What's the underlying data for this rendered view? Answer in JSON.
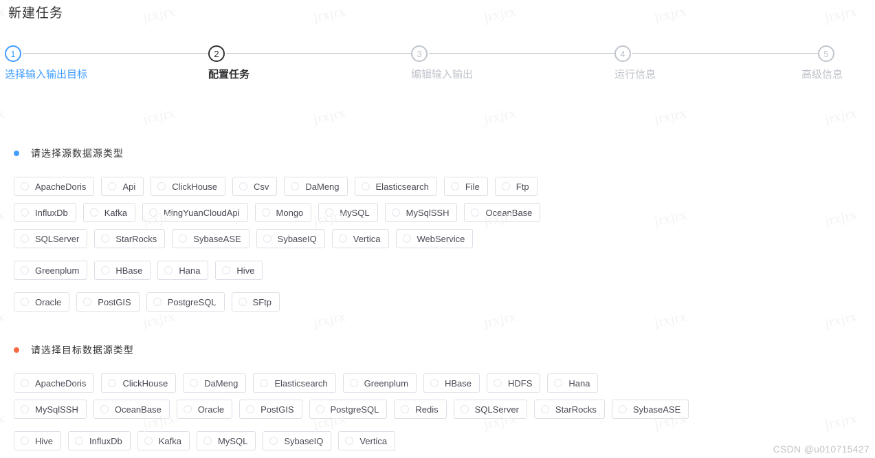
{
  "header": {
    "title": "新建任务"
  },
  "steps": [
    {
      "num": "1",
      "label": "选择输入输出目标",
      "state": "active"
    },
    {
      "num": "2",
      "label": "配置任务",
      "state": "done"
    },
    {
      "num": "3",
      "label": "编辑输入输出",
      "state": "pending"
    },
    {
      "num": "4",
      "label": "运行信息",
      "state": "pending"
    },
    {
      "num": "5",
      "label": "高级信息",
      "state": "pending"
    }
  ],
  "source": {
    "header_label": "请选择源数据源类型",
    "dot_color": "#409eff",
    "rows": [
      [
        "ApacheDoris",
        "Api",
        "ClickHouse",
        "Csv",
        "DaMeng",
        "Elasticsearch",
        "File",
        "Ftp"
      ],
      [
        "InfluxDb",
        "Kafka",
        "MingYuanCloudApi",
        "Mongo",
        "MySQL",
        "MySqlSSH",
        "OceanBase"
      ],
      [
        "SQLServer",
        "StarRocks",
        "SybaseASE",
        "SybaseIQ",
        "Vertica",
        "WebService"
      ],
      [
        "Greenplum",
        "HBase",
        "Hana",
        "Hive"
      ],
      [
        "Oracle",
        "PostGIS",
        "PostgreSQL",
        "SFtp"
      ]
    ]
  },
  "target": {
    "header_label": "请选择目标数据源类型",
    "dot_color": "#f56a42",
    "rows": [
      [
        "ApacheDoris",
        "ClickHouse",
        "DaMeng",
        "Elasticsearch",
        "Greenplum",
        "HBase",
        "HDFS",
        "Hana"
      ],
      [
        "MySqlSSH",
        "OceanBase",
        "Oracle",
        "PostGIS",
        "PostgreSQL",
        "Redis",
        "SQLServer",
        "StarRocks",
        "SybaseASE"
      ],
      [
        "Hive",
        "InfluxDb",
        "Kafka",
        "MySQL",
        "SybaseIQ",
        "Vertica"
      ]
    ]
  },
  "watermark": {
    "tile_text": "jrxjrx",
    "csdn_text": "CSDN @u010715427"
  },
  "colors": {
    "accent_blue": "#409eff",
    "accent_orange": "#f56a42",
    "border": "#dcdfe6",
    "text_primary": "#303133",
    "text_muted": "#c0c4cc"
  }
}
